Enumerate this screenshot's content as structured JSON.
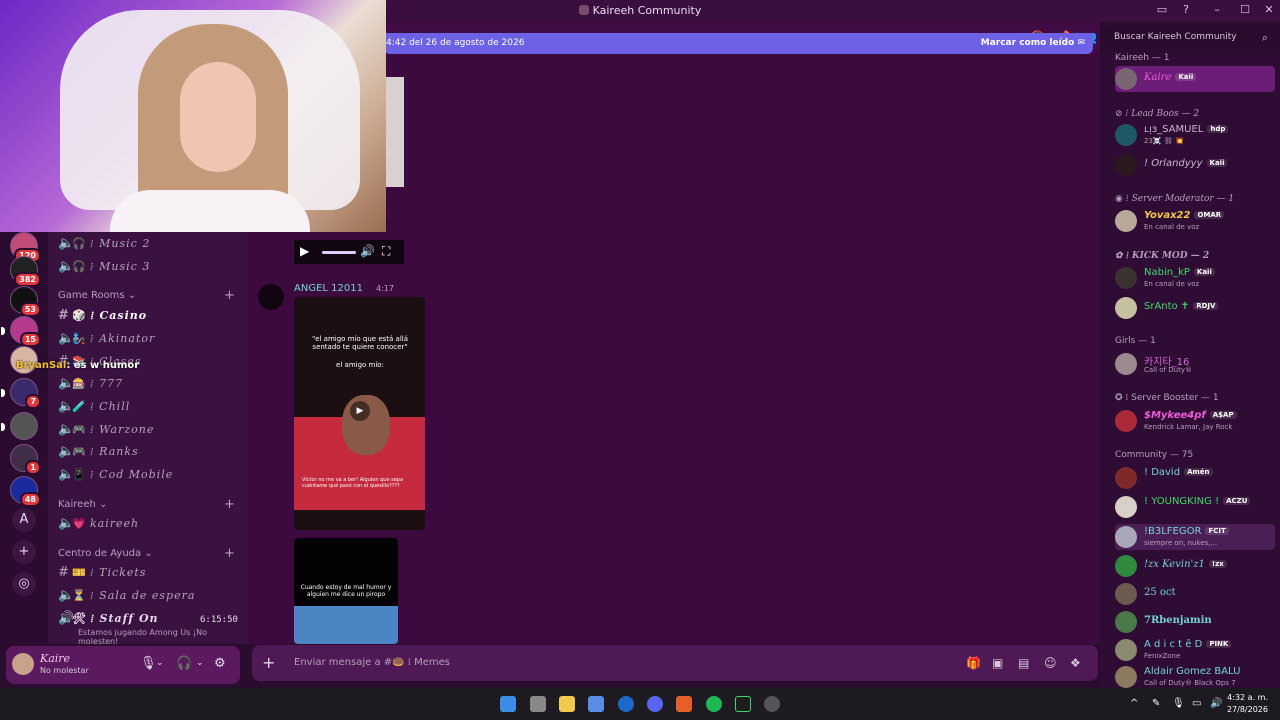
{
  "window": {
    "title": "Kaireeh Community"
  },
  "servers": [
    {
      "badge": "120"
    },
    {
      "badge": "382"
    },
    {
      "badge": "53"
    },
    {
      "badge": "15"
    },
    {
      "badge": ""
    },
    {
      "badge": "7"
    },
    {
      "badge": ""
    },
    {
      "badge": "1"
    },
    {
      "badge": "48"
    }
  ],
  "server_letter": "A",
  "channels": {
    "voice_music": [
      {
        "label": "Music 2"
      },
      {
        "label": "Music 3"
      }
    ],
    "game_rooms": {
      "category": "Game Rooms",
      "items": [
        {
          "label": "Casino"
        },
        {
          "label": "Akinator"
        },
        {
          "label": "Clases"
        },
        {
          "label": "777"
        },
        {
          "label": "Chill"
        },
        {
          "label": "Warzone"
        },
        {
          "label": "Ranks"
        },
        {
          "label": "Cod Mobile"
        }
      ]
    },
    "kaireeh": {
      "category": "Kaireeh",
      "items": [
        {
          "label": "kaireeh"
        }
      ]
    },
    "help": {
      "category": "Centro de Ayuda",
      "items": [
        {
          "label": "Tickets"
        },
        {
          "label": "Sala de espera"
        },
        {
          "label": "Staff On"
        }
      ],
      "staff_time": "6:15:50",
      "staff_status": "Estamos jugando Among Us ¡No molesten!"
    }
  },
  "overlay": {
    "user": "BryanSal",
    "text": ": es w humor"
  },
  "user": {
    "name": "Kaire",
    "status": "No molestar"
  },
  "banner": {
    "text": "4:42 del 26 de agosto de 2026",
    "mark_read": "Marcar como leído"
  },
  "message": {
    "author": "ANGEL 12011",
    "time": "4:17",
    "video1": {
      "caption": "\"el amigo mío que está allá sentado te quiere conocer\"",
      "sub": "el amigo mío:",
      "comment": "Víctor no me va a ber! Alguien que sepa cuéntame qué pasó con el quesillo????"
    },
    "video2": {
      "caption": "Cuando estoy de mal humor y alguien me dice un piropo"
    }
  },
  "composer": {
    "placeholder": "Enviar mensaje a #🍩 ⁞ Memes"
  },
  "search": {
    "placeholder": "Buscar Kaireeh Community"
  },
  "members": {
    "groups": [
      {
        "title": "Kaireeh — 1"
      },
      {
        "title": "Lead Boos — 2"
      },
      {
        "title": "Server Moderator — 1"
      },
      {
        "title": "KICK MOD — 2"
      },
      {
        "title": "Girls — 1"
      },
      {
        "title": "Server Booster — 1"
      },
      {
        "title": "Community — 75"
      }
    ],
    "list": [
      {
        "name": "Kaire",
        "tag": "Kaii",
        "sub": "",
        "color": "#f05bd8"
      },
      {
        "name": "ʟᴉɜ_SAMUEL",
        "tag": "hdp",
        "sub": "23☠️ ⛓ 💥",
        "color": "#c9b7d0"
      },
      {
        "name": "! Orlandyyy",
        "tag": "Kaii",
        "sub": "",
        "color": "#c9b7d0"
      },
      {
        "name": "Yovax22",
        "tag": "OMAR",
        "sub": "En canal de voz",
        "color": "#f2c94c"
      },
      {
        "name": "Nabin_kP",
        "tag": "Kaii",
        "sub": "En canal de voz",
        "color": "#3fd96a"
      },
      {
        "name": "SrAnto ✝",
        "tag": "RDJV",
        "sub": "",
        "color": "#3fd96a"
      },
      {
        "name": "카지타_16",
        "tag": "",
        "sub": "Call of Duty®",
        "color": "#d26ad8"
      },
      {
        "name": "$Mykee4pf",
        "tag": "A$AP",
        "sub": "Kendrick Lamar, Jay Rock",
        "color": "#f05bd8"
      },
      {
        "name": "! David",
        "tag": "Amén",
        "sub": "",
        "color": "#73d3d6"
      },
      {
        "name": "! YOUNGKING !",
        "tag": "ACZU",
        "sub": "",
        "color": "#3fd96a"
      },
      {
        "name": "!B3LFEGOR",
        "tag": "FCIT",
        "sub": "siempre on, nukes,...",
        "color": "#73d3d6"
      },
      {
        "name": "!zx Kevin'z1",
        "tag": "!zx",
        "sub": "",
        "color": "#73d3d6"
      },
      {
        "name": "25 oct",
        "tag": "",
        "sub": "",
        "color": "#73d3d6"
      },
      {
        "name": "7Rbenjamin",
        "tag": "",
        "sub": "",
        "color": "#73d3d6"
      },
      {
        "name": "A d i c t ē D",
        "tag": "PINK",
        "sub": "FenixZone",
        "color": "#73d3d6"
      },
      {
        "name": "Aldair Gomez BALU",
        "tag": "",
        "sub": "Call of Duty® Black Ops 7",
        "color": "#73d3d6"
      }
    ]
  },
  "clock": {
    "time": "4:32 a. m.",
    "date": "27/8/2026"
  }
}
